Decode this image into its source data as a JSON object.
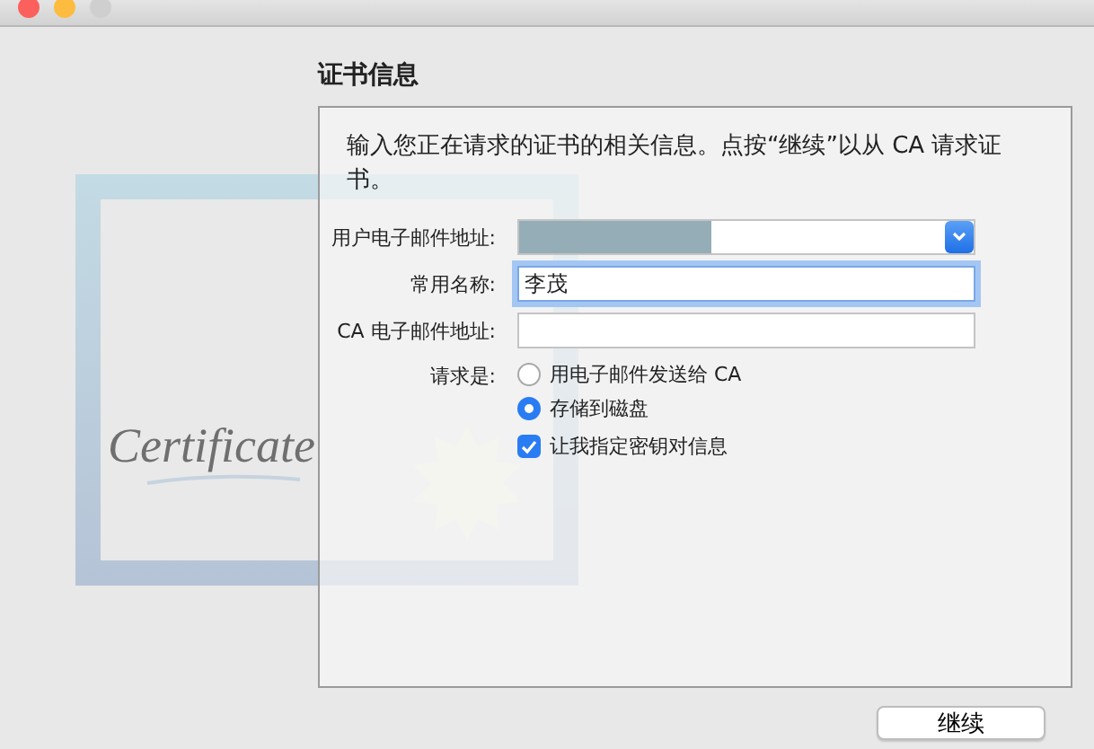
{
  "certificate_art": {
    "script": "Certificate"
  },
  "heading": "证书信息",
  "description": "输入您正在请求的证书的相关信息。点按“继续”以从 CA 请求证书。",
  "fields": [
    {
      "label": "用户电子邮件地址:",
      "kind": "dropdown",
      "redacted": true,
      "focused": false
    },
    {
      "label": "常用名称:",
      "kind": "text",
      "value": "李茂",
      "focused": true
    },
    {
      "label": "CA 电子邮件地址:",
      "kind": "text",
      "focused": false
    }
  ],
  "request": {
    "label": "请求是:",
    "options": [
      {
        "label": "用电子邮件发送给 CA",
        "selected": false
      },
      {
        "label": "存储到磁盘",
        "selected": true
      }
    ]
  },
  "key_pair_option": {
    "label": "让我指定密钥对信息",
    "checked": true
  },
  "buttons": [
    "继续"
  ]
}
